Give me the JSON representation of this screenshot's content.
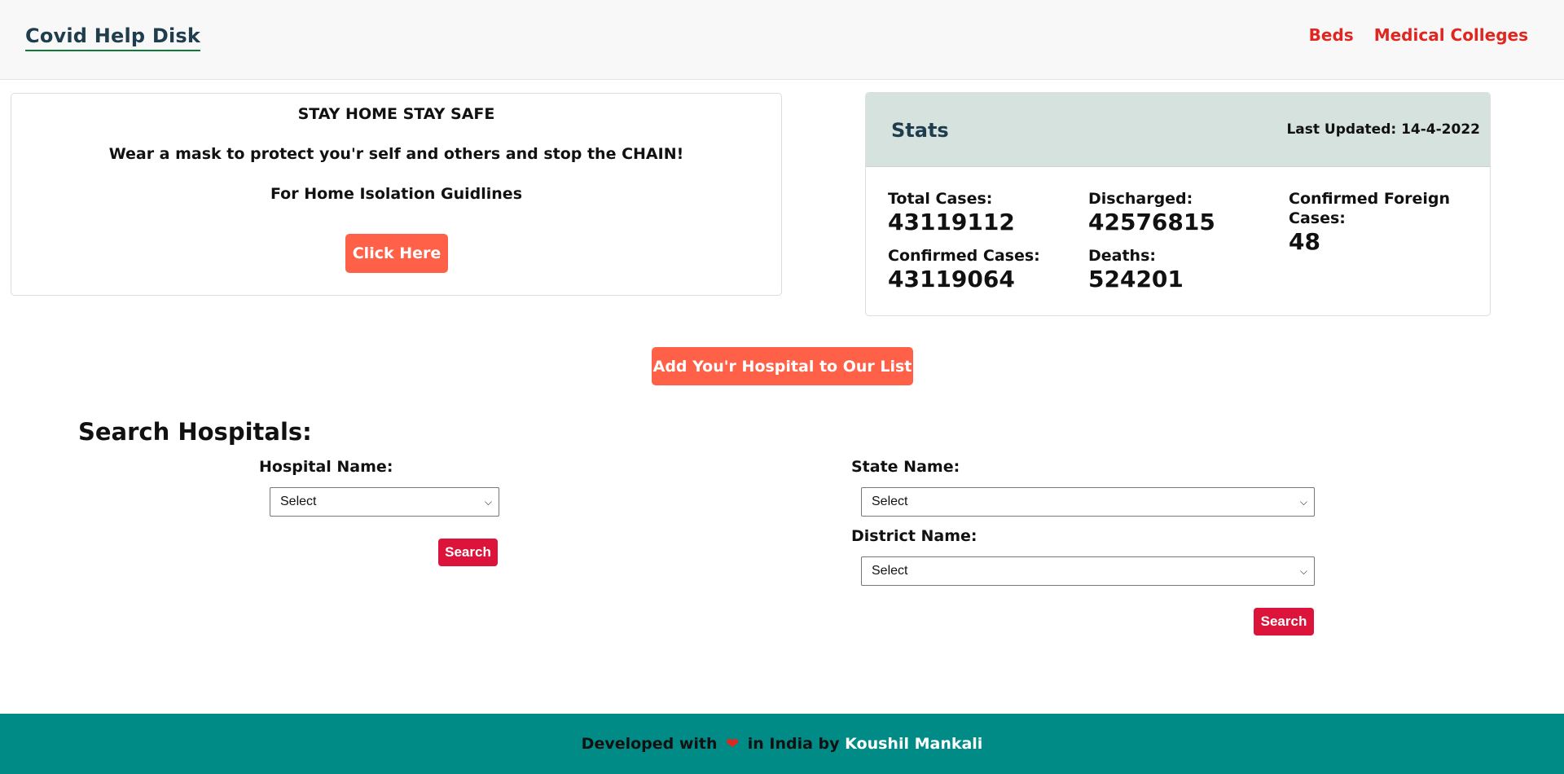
{
  "header": {
    "brand": "Covid Help Disk",
    "nav": [
      "Beds",
      "Medical Colleges"
    ]
  },
  "info": {
    "line1": "STAY HOME STAY SAFE",
    "line2": "Wear a mask to protect you'r self and others and stop the CHAIN!",
    "line3": "For Home Isolation Guidlines",
    "button": "Click Here"
  },
  "stats": {
    "title": "Stats",
    "last_updated": "Last Updated: 14-4-2022",
    "total_label": "Total Cases:",
    "total_value": "43119112",
    "confirmed_label": "Confirmed Cases:",
    "confirmed_value": "43119064",
    "discharged_label": "Discharged:",
    "discharged_value": "42576815",
    "deaths_label": "Deaths:",
    "deaths_value": "524201",
    "foreign_label": "Confirmed Foreign Cases:",
    "foreign_value": "48"
  },
  "add_hospital_button": "Add You'r Hospital to Our List",
  "search": {
    "title": "Search Hospitals:",
    "hospital_label": "Hospital Name:",
    "hospital_selected": "Select",
    "state_label": "State Name:",
    "state_selected": "Select",
    "district_label": "District Name:",
    "district_selected": "Select",
    "search_button": "Search"
  },
  "footer": {
    "prefix": "Developed with",
    "heart": "❤",
    "middle": "in India by",
    "author": "Koushil Mankali"
  },
  "colors": {
    "accent_orange": "#ff6148",
    "search_red": "#dc143c",
    "nav_red": "#e0261f",
    "footer_teal": "#008b87",
    "stats_header": "#d6e2dd"
  }
}
